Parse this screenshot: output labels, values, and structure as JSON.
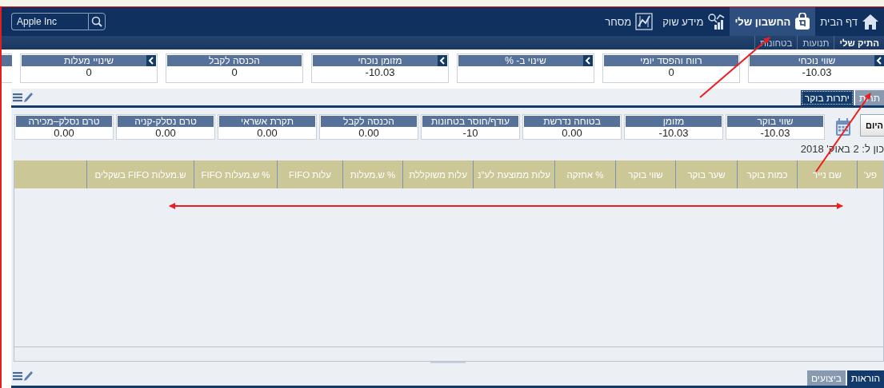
{
  "nav": {
    "items": [
      {
        "label": "דף הבית",
        "selected": false
      },
      {
        "label": "החשבון שלי",
        "selected": true
      },
      {
        "label": "מידע שוק",
        "selected": false
      },
      {
        "label": "מסחר",
        "selected": false
      }
    ],
    "search": {
      "value": "Apple Inc"
    }
  },
  "subnav": [
    {
      "label": "התיק שלי",
      "selected": true
    },
    {
      "label": "תנועות",
      "selected": false
    },
    {
      "label": "בטחונות",
      "selected": false
    }
  ],
  "summary_cards": [
    {
      "label": "שווי נוכחי",
      "value": "-10.03",
      "expandable": true
    },
    {
      "label": "רווח והפסד יומי",
      "value": "0",
      "expandable": false
    },
    {
      "label": "שינוי ב- %",
      "expandable": true
    },
    {
      "label": "מזומן נוכחי",
      "value": "-10.03",
      "expandable": true
    },
    {
      "label": "הכנסה לקבל",
      "value": "0",
      "expandable": false
    },
    {
      "label": "שינויי מעלות",
      "value": "0",
      "expandable": true
    }
  ],
  "panel": {
    "tabs": [
      {
        "label": "תרות",
        "selected": false
      },
      {
        "label": "יתרות בוקר",
        "selected": true
      }
    ],
    "today_button": "היום",
    "cards": [
      {
        "label": "שווי בוקר",
        "value": "-10.03"
      },
      {
        "label": "מזומן",
        "value": "-10.03"
      },
      {
        "label": "בטוחה נדרשת",
        "value": "0.00"
      },
      {
        "label": "עודף/חוסר בטחונות",
        "value": "-10"
      },
      {
        "label": "הכנסה לקבל",
        "value": "0.00"
      },
      {
        "label": "תקרת אשראי",
        "value": "0.00"
      },
      {
        "label": "טרם נסלק-קניה",
        "value": "0.00"
      },
      {
        "label": "טרם נסלק–מכירה",
        "value": "0.00"
      }
    ],
    "as_of": "כון ל: 2 באוק' 2018",
    "table": {
      "columns": [
        "פע'",
        "שם נייר",
        "כמות בוקר",
        "שער בוקר",
        "שווי בוקר",
        "% אחזקה",
        "עלות ממוצעת לע\"נ",
        "עלות משוקללת",
        "% ש.מעלות",
        "עלות FIFO",
        "% ש.מעלות FIFO",
        "ש.מעלות FIFO בשקלים"
      ]
    }
  },
  "bottom_tabs": [
    {
      "label": "הוראות",
      "selected": true
    },
    {
      "label": "ביצועים",
      "selected": false
    }
  ]
}
